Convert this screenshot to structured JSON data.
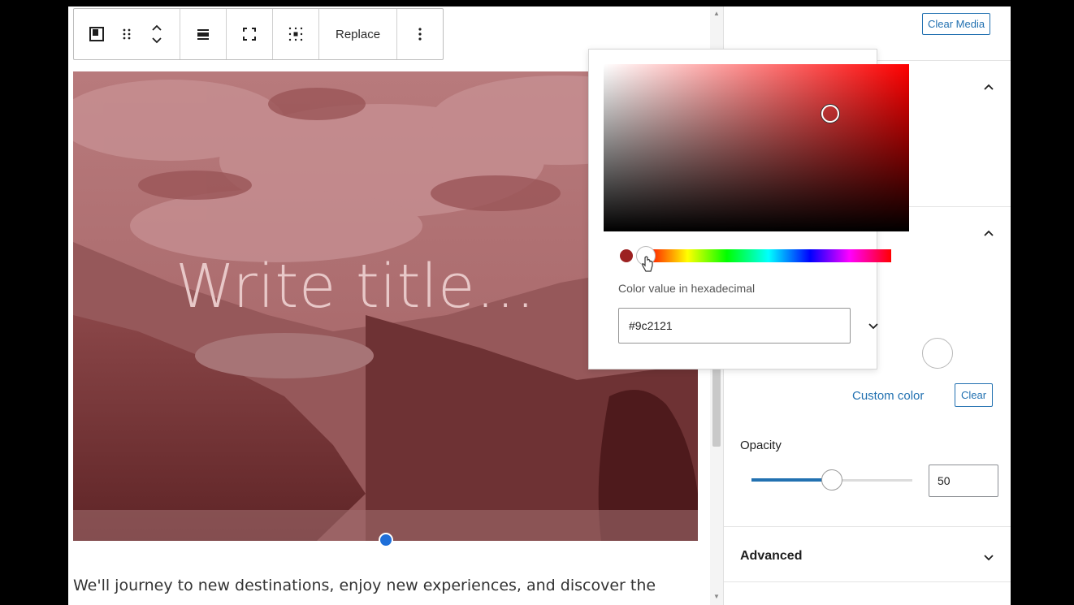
{
  "toolbar": {
    "replace_label": "Replace",
    "icons": [
      "cover-block-icon",
      "drag-handle-icon",
      "move-up-down-icon",
      "align-icon",
      "full-height-icon",
      "position-grid-icon",
      "more-options-icon"
    ]
  },
  "cover": {
    "title_placeholder": "Write title…",
    "overlay_color": "#9c2121"
  },
  "content": {
    "paragraph": "We'll journey to new destinations, enjoy new experiences, and discover the"
  },
  "color_picker": {
    "hex_label": "Color value in hexadecimal",
    "hex_value": "#9c2121",
    "hue_color": "#ff0000",
    "saturation_value": 0.79,
    "brightness_value": 0.61
  },
  "sidebar": {
    "clear_media_label": "Clear Media",
    "custom_color_label": "Custom color",
    "clear_label": "Clear",
    "opacity_label": "Opacity",
    "opacity_value": "50",
    "opacity_fraction": 0.5,
    "advanced_label": "Advanced"
  },
  "colors": {
    "accent": "#2271b1",
    "handle_blue": "#1e6fd9"
  }
}
